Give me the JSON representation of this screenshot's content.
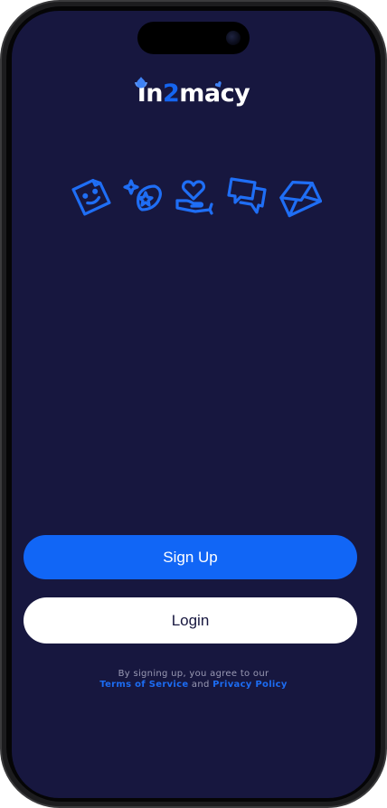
{
  "app": {
    "logo_prefix": "In",
    "logo_number": "2",
    "logo_suffix": "macy",
    "logo_icons": [
      "flame-icon",
      "heart-icon"
    ]
  },
  "feature_icons": [
    "sticker-smile-icon",
    "sparkle-star-icon",
    "heart-hand-icon",
    "chat-bubbles-icon",
    "envelope-icon"
  ],
  "buttons": {
    "signup_label": "Sign Up",
    "login_label": "Login"
  },
  "terms": {
    "prefix": "By signing up, you agree to our",
    "terms_link": "Terms of Service",
    "conjunction": "and",
    "privacy_link": "Privacy Policy"
  },
  "colors": {
    "background": "#17173f",
    "accent": "#1166f6",
    "logo_number": "#1565f0",
    "login_button": "#ffffff",
    "terms_text": "#9a9ab4"
  }
}
